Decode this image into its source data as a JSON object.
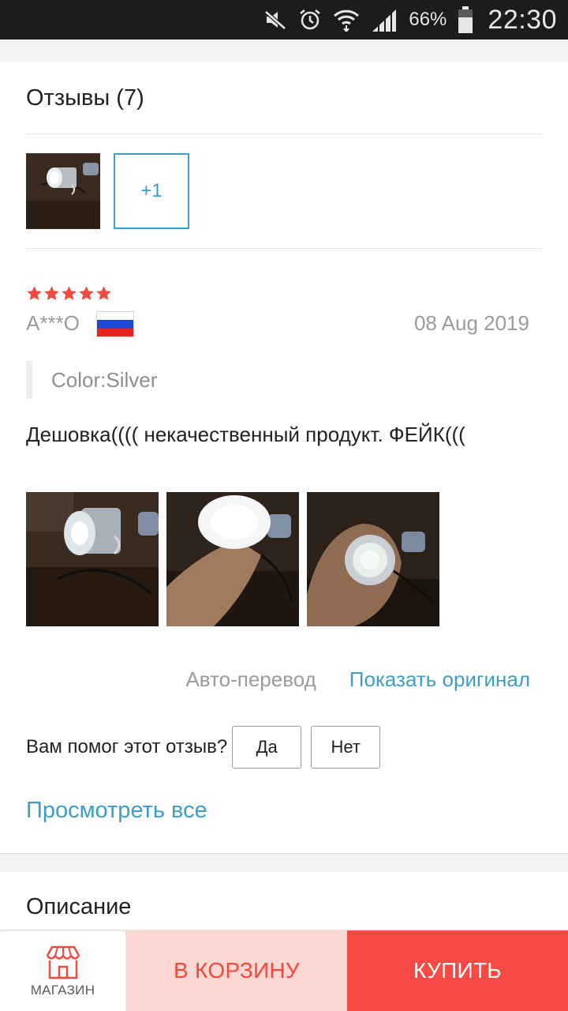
{
  "status_bar": {
    "battery_percent": "66%",
    "time": "22:30",
    "icons": [
      "mute-icon",
      "alarm-icon",
      "wifi-icon",
      "signal-icon",
      "battery-icon"
    ]
  },
  "reviews": {
    "title": "Отзывы (7)",
    "more_photos": "+1",
    "review": {
      "rating": 5,
      "author": "A***O",
      "country_flag": "russia-flag-icon",
      "date": "08 Aug 2019",
      "attribute": "Color:Silver",
      "text": "Дешовка(((( некачественный продукт. ФЕЙК(((",
      "translation_label": "Авто-перевод",
      "show_original": "Показать оригинал"
    },
    "helpful": {
      "question": "Вам помог этот отзыв?",
      "yes": "Да",
      "no": "Нет"
    },
    "view_all": "Просмотреть все"
  },
  "description": {
    "title": "Описание"
  },
  "bottom_bar": {
    "shop_label": "МАГАЗИН",
    "add_to_cart": "В КОРЗИНУ",
    "buy": "КУПИТЬ"
  },
  "colors": {
    "accent_blue": "#3e9ec7",
    "star_red": "#f0493e",
    "buy_red": "#f74a44",
    "cart_pink": "#fdd7d2"
  }
}
